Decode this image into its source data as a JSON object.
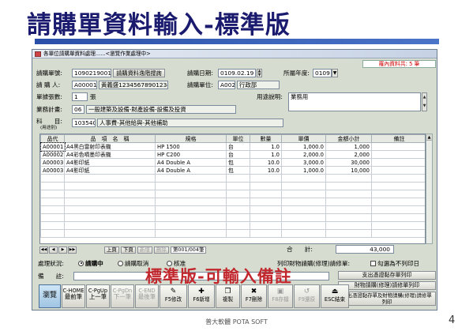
{
  "slide": {
    "title": "請購單資料輸入-標準版",
    "overlay": "標準版-可輸入備註",
    "footer": "普大軟體 POTA SOFT",
    "page_number": "4"
  },
  "window": {
    "title": "各單位請購單資料處理......<瀏覽作業處理中>",
    "record_count": "羅內資料共: 5 筆"
  },
  "form": {
    "req_no_label": "請購單號:",
    "req_no_value": "1090219001",
    "inquiry_button": "請購資料逸階搜詢",
    "req_date_label": "請購日期:",
    "req_date_value": "0109.02.19",
    "fiscal_year_label": "所屬年度:",
    "fiscal_year_value": "0109",
    "requester_label": "請 購 人:",
    "requester_code": "A00001",
    "requester_name": "黃義盛12345678901234",
    "req_unit_label": "請購單位:",
    "req_unit_code": "A002",
    "req_unit_name": "行政部",
    "attachment_label": "單據張數:",
    "attachment_value": "1",
    "attachment_unit": "張",
    "purpose_label": "用途說明:",
    "purpose_value": "業務用",
    "business_label": "業務計畫:",
    "business_code": "06",
    "business_name": "一般建築及設備-財產設備-設備及投資",
    "account_label": "科　　目:",
    "account_sublabel": "(用途別)",
    "account_code": "103540",
    "account_name": "人事費-其他給與-其他補助"
  },
  "grid": {
    "columns": [
      "品代",
      "品　項　名　稱",
      "規格",
      "單位",
      "數量",
      "單價",
      "金額小計",
      "備註"
    ],
    "rows": [
      [
        "A00001",
        "A4黑白雷射印表機",
        "HP 1500",
        "台",
        "1.0",
        "1,000.0",
        "1,000",
        ""
      ],
      [
        "A00002",
        "A4彩色噴墨印表機",
        "HP C200",
        "台",
        "1.0",
        "2,000.0",
        "2,000",
        ""
      ],
      [
        "A00003",
        "A4影印紙",
        "A4 Double A",
        "包",
        "10.0",
        "3,000.0",
        "30,000",
        ""
      ],
      [
        "A00003",
        "A4影印紙",
        "A4 Double A",
        "包",
        "10.0",
        "1,000.0",
        "10,000",
        ""
      ]
    ],
    "empty_rows": 8
  },
  "navigation": {
    "top": "上頁",
    "down": "下頁",
    "add": "新增",
    "delete": "刪除",
    "page_info": "第001/004筆"
  },
  "total": {
    "label": "合　　計:",
    "value": "43,000"
  },
  "status": {
    "label": "處理狀況:",
    "options": [
      "請購中",
      "請購取消",
      "核准"
    ],
    "selected": "請購中"
  },
  "notes": {
    "label": "備　　註:",
    "value": ""
  },
  "print_options": {
    "checkbox_prefix": "列印財物請購(修理)請修單:",
    "checkbox_label": "勾選為不列印日",
    "buttons": [
      "支出憑證黏存單列印",
      "財物請購(修理)請修單列印",
      "支出憑證黏存單及財物請購(修理)請修單列印"
    ]
  },
  "toolbar": [
    {
      "label": "瀏覽",
      "icon": "",
      "enabled": true
    },
    {
      "label": "C-HOME",
      "sub": "最前筆",
      "icon": "",
      "enabled": true
    },
    {
      "label": "C-PgUp",
      "sub": "上一筆",
      "icon": "",
      "enabled": true
    },
    {
      "label": "C-PgDn",
      "sub": "下一筆",
      "icon": "",
      "enabled": false
    },
    {
      "label": "C-END",
      "sub": "最後筆",
      "icon": "",
      "enabled": false
    },
    {
      "label": "F5修改",
      "icon": "✎",
      "enabled": true
    },
    {
      "label": "F6新增",
      "icon": "✚",
      "enabled": true
    },
    {
      "label": "複製",
      "icon": "❐",
      "enabled": true
    },
    {
      "label": "F7刪除",
      "icon": "✖",
      "enabled": true
    },
    {
      "label": "F8存檔",
      "icon": "▣",
      "enabled": false
    },
    {
      "label": "F9還原",
      "icon": "↺",
      "enabled": false
    },
    {
      "label": "ESC結束",
      "icon": "⏏",
      "enabled": true
    }
  ],
  "colors": {
    "title": "#1a1a6e",
    "overlay": "#c1272d",
    "window_bg": "#d6dccf",
    "count_text": "#cc0000"
  }
}
